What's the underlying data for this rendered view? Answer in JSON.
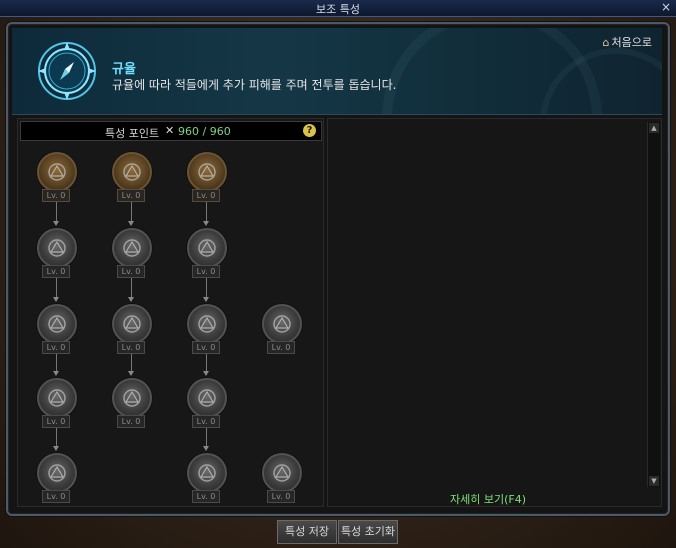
{
  "window": {
    "title": "보조 특성",
    "close_glyph": "×"
  },
  "header": {
    "trait_name": "규율",
    "trait_desc": "규율에 따라 적들에게 추가 피해를 주며 전투를 돕습니다.",
    "home_label": "처음으로",
    "home_icon": "home-icon",
    "accent": "#6fe0ff"
  },
  "points": {
    "label": "특성 포인트",
    "value": "960 / 960",
    "help": "?"
  },
  "nodes": [
    {
      "lv": "Lv. 0"
    },
    {
      "lv": "Lv. 0"
    },
    {
      "lv": "Lv. 0"
    },
    {
      "lv": "Lv. 0"
    },
    {
      "lv": "Lv. 0"
    },
    {
      "lv": "Lv. 0"
    },
    {
      "lv": "Lv. 0"
    },
    {
      "lv": "Lv. 0"
    },
    {
      "lv": "Lv. 0"
    },
    {
      "lv": "Lv. 0"
    },
    {
      "lv": "Lv. 0"
    },
    {
      "lv": "Lv. 0"
    },
    {
      "lv": "Lv. 0"
    },
    {
      "lv": "Lv. 0"
    },
    {
      "lv": "Lv. 0"
    },
    {
      "lv": "Lv. 0"
    }
  ],
  "detail": {
    "link_label": "자세히 보기(F4)"
  },
  "footer": {
    "save_label": "특성 저장",
    "reset_label": "특성 초기화"
  }
}
